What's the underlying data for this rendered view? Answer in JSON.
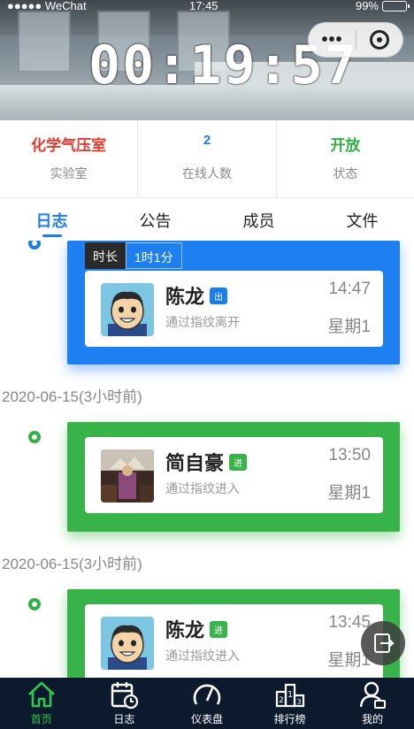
{
  "status_bar": {
    "carrier": "●●●●● WeChat",
    "time": "17:45",
    "battery": "99%"
  },
  "timer": "00:19:57",
  "info": [
    {
      "value": "化学气压室",
      "label": "实验室",
      "color": "#e53a2e"
    },
    {
      "value": "2",
      "label": "在线人数",
      "color": "#1b7ee6"
    },
    {
      "value": "开放",
      "label": "状态",
      "color": "#2fb147"
    }
  ],
  "tabs": [
    "日志",
    "公告",
    "成员",
    "文件"
  ],
  "active_tab": "日志",
  "records": [
    {
      "duration_label": "时长",
      "duration": "1时1分",
      "name": "陈龙",
      "badge": "出",
      "method": "通过指纹离开",
      "time": "14:47",
      "weekday": "星期1",
      "color": "blue"
    },
    {
      "date": "2020-06-15(3小时前)",
      "name": "简自豪",
      "badge": "进",
      "method": "通过指纹进入",
      "time": "13:50",
      "weekday": "星期1",
      "color": "green"
    },
    {
      "date": "2020-06-15(3小时前)",
      "name": "陈龙",
      "badge": "进",
      "method": "通过指纹进入",
      "time": "13:45",
      "weekday": "星期1",
      "color": "green"
    }
  ],
  "nav": [
    {
      "label": "首页",
      "icon": "home-icon",
      "active": true
    },
    {
      "label": "日志",
      "icon": "calendar-clock-icon",
      "active": false
    },
    {
      "label": "仪表盘",
      "icon": "gauge-icon",
      "active": false
    },
    {
      "label": "排行榜",
      "icon": "podium-icon",
      "active": false
    },
    {
      "label": "我的",
      "icon": "user-icon",
      "active": false
    }
  ],
  "colors": {
    "blue": "#1e7ff0",
    "green": "#37b34a",
    "nav_bg": "#0d1a2e",
    "nav_active": "#2fc84a"
  }
}
